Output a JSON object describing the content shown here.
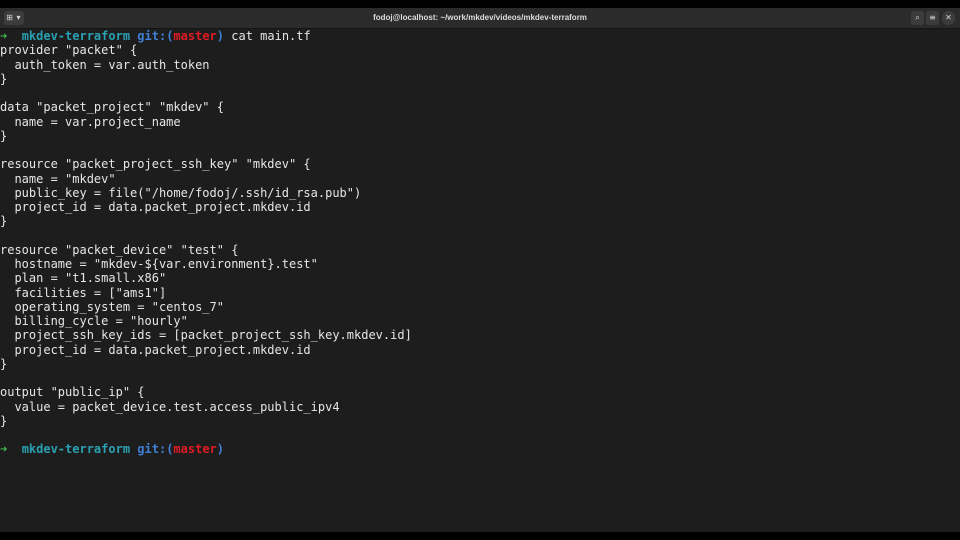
{
  "window": {
    "title": "fodoj@localhost: ~/work/mkdev/videos/mkdev-terraform"
  },
  "titlebar_icons": {
    "new_tab": "new-tab-icon",
    "dropdown": "chevron-down-icon",
    "search": "search-icon",
    "menu": "hamburger-menu-icon",
    "close": "close-icon"
  },
  "prompt": {
    "arrow": "➜",
    "directory": "mkdev-terraform",
    "git_prefix": "git:(",
    "branch": "master",
    "git_suffix": ")"
  },
  "command": "cat main.tf",
  "output_lines": [
    "provider \"packet\" {",
    "  auth_token = var.auth_token",
    "}",
    "",
    "data \"packet_project\" \"mkdev\" {",
    "  name = var.project_name",
    "}",
    "",
    "resource \"packet_project_ssh_key\" \"mkdev\" {",
    "  name = \"mkdev\"",
    "  public_key = file(\"/home/fodoj/.ssh/id_rsa.pub\")",
    "  project_id = data.packet_project.mkdev.id",
    "}",
    "",
    "resource \"packet_device\" \"test\" {",
    "  hostname = \"mkdev-${var.environment}.test\"",
    "  plan = \"t1.small.x86\"",
    "  facilities = [\"ams1\"]",
    "  operating_system = \"centos_7\"",
    "  billing_cycle = \"hourly\"",
    "  project_ssh_key_ids = [packet_project_ssh_key.mkdev.id]",
    "  project_id = data.packet_project.mkdev.id",
    "}",
    "",
    "output \"public_ip\" {",
    "  value = packet_device.test.access_public_ipv4",
    "}",
    ""
  ],
  "colors": {
    "arrow": "#3fb950",
    "directory": "#2aa1b3",
    "git": "#3f7fd6",
    "branch": "#e01b24",
    "text": "#e6e6e6",
    "background": "#1d1d1d"
  }
}
